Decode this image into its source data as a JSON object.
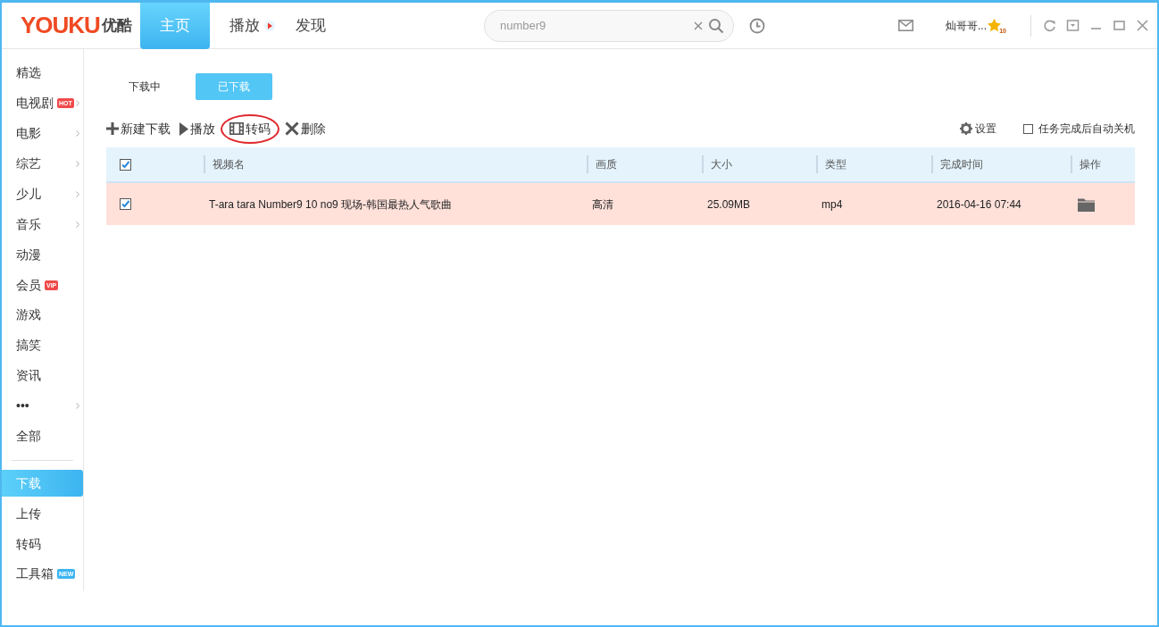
{
  "header": {
    "logo_text": "YOUKU",
    "logo_cn": "优酷",
    "nav": [
      {
        "label": "主页",
        "selected": true,
        "play_icon": false
      },
      {
        "label": "播放",
        "selected": false,
        "play_icon": true
      },
      {
        "label": "发现",
        "selected": false,
        "play_icon": false
      }
    ],
    "search": {
      "value": "number9"
    },
    "user": {
      "name": "灿哥哥...",
      "level": "10"
    }
  },
  "sidebar": {
    "items": [
      {
        "label": "精选",
        "selected": false,
        "arrow": false
      },
      {
        "label": "电视剧",
        "badge": "HOT",
        "color": "#f04a4a",
        "selected": false,
        "arrow": true
      },
      {
        "label": "电影",
        "selected": false,
        "arrow": true
      },
      {
        "label": "综艺",
        "selected": false,
        "arrow": true
      },
      {
        "label": "少儿",
        "selected": false,
        "arrow": true
      },
      {
        "label": "音乐",
        "selected": false,
        "arrow": true
      },
      {
        "label": "动漫",
        "selected": false,
        "arrow": false
      },
      {
        "label": "会员",
        "badge": "VIP",
        "color": "#f04a4a",
        "selected": false,
        "arrow": false
      },
      {
        "label": "游戏",
        "selected": false,
        "arrow": false
      },
      {
        "label": "搞笑",
        "selected": false,
        "arrow": false
      },
      {
        "label": "资讯",
        "selected": false,
        "arrow": false
      },
      {
        "label": "•••",
        "selected": false,
        "arrow": true
      },
      {
        "label": "全部",
        "selected": false,
        "arrow": false
      }
    ],
    "tools": [
      {
        "label": "下载",
        "selected": true
      },
      {
        "label": "上传",
        "selected": false
      },
      {
        "label": "转码",
        "selected": false
      },
      {
        "label": "工具箱",
        "badge": "NEW",
        "color": "#3bb4f2",
        "selected": false
      }
    ]
  },
  "tabs": [
    {
      "label": "下载中",
      "selected": false
    },
    {
      "label": "已下载",
      "selected": true
    }
  ],
  "toolbar": {
    "actions": [
      {
        "label": "新建下载",
        "kind": "plus",
        "circled": false
      },
      {
        "label": "播放",
        "kind": "play",
        "circled": false
      },
      {
        "label": "转码",
        "kind": "film",
        "circled": true
      },
      {
        "label": "删除",
        "kind": "delete",
        "circled": false
      }
    ],
    "settings": "设置",
    "auto_shutdown": {
      "label": "任务完成后自动关机",
      "checked": false
    }
  },
  "table": {
    "all_checked": true,
    "columns": [
      "视频名",
      "画质",
      "大小",
      "类型",
      "完成时间",
      "操作"
    ],
    "rows": [
      {
        "checked": true,
        "cells": [
          "T-ara tara Number9 10 no9 现场-韩国最热人气歌曲",
          "高清",
          "25.09MB",
          "mp4",
          "2016-04-16 07:44"
        ]
      }
    ]
  }
}
